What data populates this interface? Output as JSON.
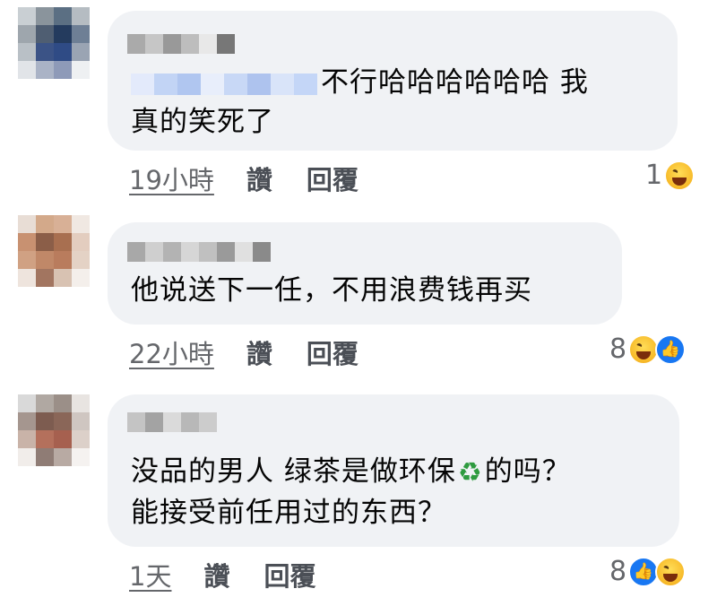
{
  "comments": [
    {
      "text_lines": [
        "不行哈哈哈哈哈哈 我",
        "真的笑死了"
      ],
      "time": "19小時",
      "like_label": "讚",
      "reply_label": "回覆",
      "reaction_count": "1",
      "reactions": [
        "haha-emoji"
      ]
    },
    {
      "text_lines": [
        "他说送下一任，不用浪费钱再买"
      ],
      "time": "22小時",
      "like_label": "讚",
      "reply_label": "回覆",
      "reaction_count": "8",
      "reactions": [
        "haha-emoji",
        "like-emoji"
      ]
    },
    {
      "text_lines": [
        "没品的男人  绿茶是做环保",
        "的吗？",
        "能接受前任用过的东西？"
      ],
      "recycle_symbol": "♻",
      "time": "1天",
      "like_label": "讚",
      "reply_label": "回覆",
      "reaction_count": "8",
      "reactions": [
        "like-emoji",
        "haha-emoji"
      ]
    }
  ],
  "colors": {
    "bubble": "#f0f2f5",
    "meta_text": "#65676b",
    "like_blue": "#1877f2",
    "haha_yellow": "#f7b928"
  }
}
